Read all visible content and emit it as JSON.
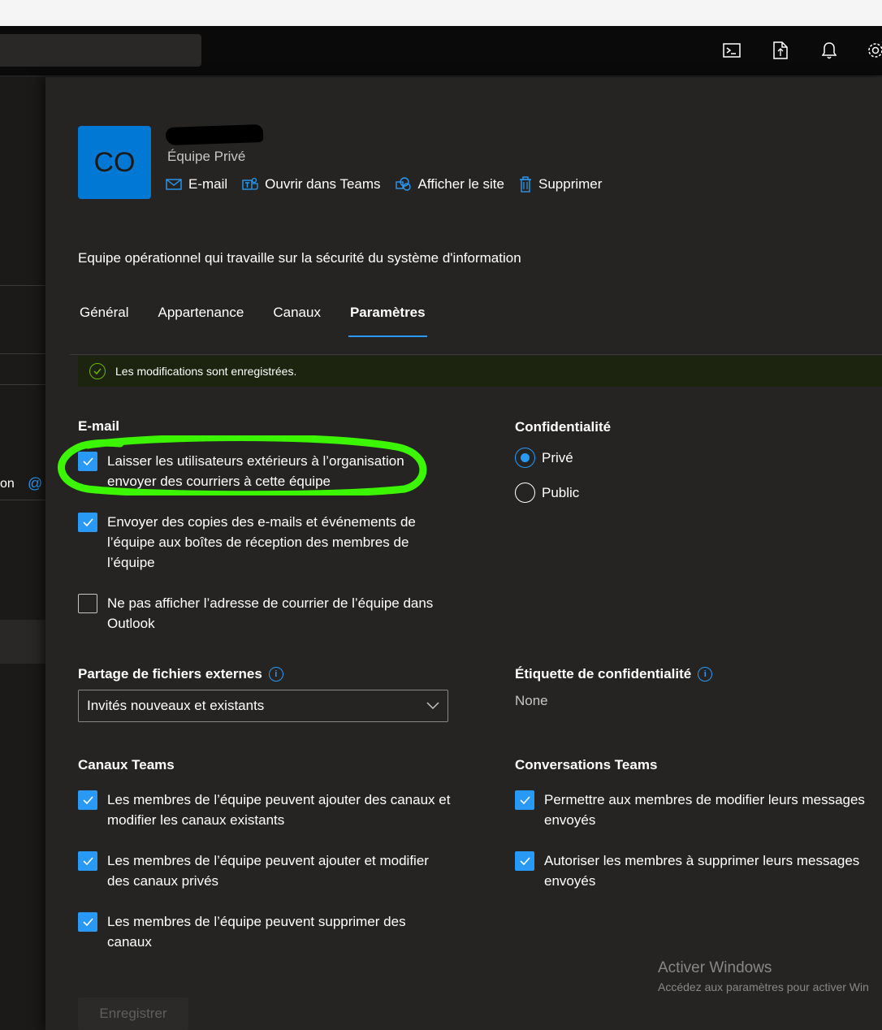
{
  "team": {
    "avatar_initials": "CO",
    "type": "Équipe Privé",
    "description": "Equipe opérationnel qui travaille sur la sécurité du système d'information"
  },
  "actions": [
    {
      "label": "E-mail",
      "icon": "mail-icon"
    },
    {
      "label": "Ouvrir dans Teams",
      "icon": "teams-icon"
    },
    {
      "label": "Afficher le site",
      "icon": "sharepoint-icon"
    },
    {
      "label": "Supprimer",
      "icon": "trash-icon"
    }
  ],
  "tabs": [
    {
      "label": "Général",
      "active": false
    },
    {
      "label": "Appartenance",
      "active": false
    },
    {
      "label": "Canaux",
      "active": false
    },
    {
      "label": "Paramètres",
      "active": true
    }
  ],
  "message_bar": {
    "text": "Les modifications sont enregistrées.",
    "color": "#6bb700"
  },
  "left_panel": {
    "text": "on"
  },
  "email": {
    "title": "E-mail",
    "options": [
      {
        "label": "Laisser les utilisateurs extérieurs à l’organisation envoyer des courriers à cette équipe",
        "checked": true
      },
      {
        "label": "Envoyer des copies des e-mails et événements de l’équipe aux boîtes de réception des membres de l’équipe",
        "checked": true
      },
      {
        "label": "Ne pas afficher l’adresse de courrier de l’équipe dans Outlook",
        "checked": false
      }
    ]
  },
  "privacy": {
    "title": "Confidentialité",
    "options": [
      {
        "label": "Privé",
        "selected": true
      },
      {
        "label": "Public",
        "selected": false
      }
    ]
  },
  "external_sharing": {
    "title": "Partage de fichiers externes",
    "value": "Invités nouveaux et existants"
  },
  "sensitivity": {
    "title": "Étiquette de confidentialité",
    "value": "None"
  },
  "teams_channels": {
    "title": "Canaux Teams",
    "options": [
      {
        "label": "Les membres de l’équipe peuvent ajouter des canaux et modifier les canaux existants",
        "checked": true
      },
      {
        "label": "Les membres de l’équipe peuvent ajouter et modifier des canaux privés",
        "checked": true
      },
      {
        "label": "Les membres de l’équipe peuvent supprimer des canaux",
        "checked": true
      }
    ]
  },
  "teams_conversations": {
    "title": "Conversations Teams",
    "options": [
      {
        "label": "Permettre aux membres de modifier leurs messages envoyés",
        "checked": true
      },
      {
        "label": "Autoriser les membres à supprimer leurs messages envoyés",
        "checked": true
      }
    ]
  },
  "save_label": "Enregistrer",
  "watermark": {
    "title": "Activer Windows",
    "subtitle": "Accédez aux paramètres pour activer Win"
  },
  "colors": {
    "accent": "#2899f5",
    "avatar": "#0078d4",
    "highlight": "#3cf500",
    "success": "#6bb700"
  }
}
